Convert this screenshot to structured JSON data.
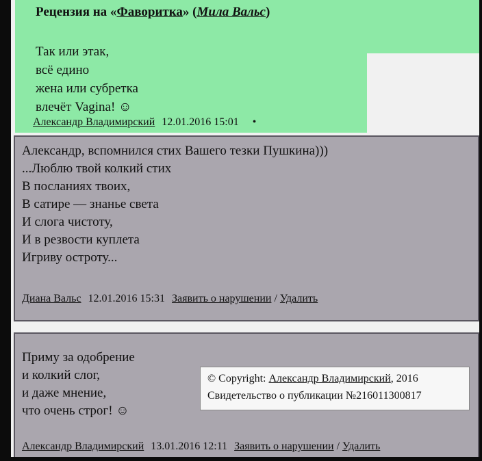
{
  "review": {
    "prefix": "Рецензия на «",
    "work_title": "Фаворитка",
    "mid": "» (",
    "work_author": "Мила Вальс",
    "suffix": ")",
    "poem": [
      "Так или этак,",
      "всё едино",
      "жена или субретка",
      "влечёт Vagina! ☺"
    ],
    "author": "Александр Владимирский",
    "date": "12.01.2016 15:01",
    "bullet": "•"
  },
  "reply1": {
    "lines": [
      "Александр, вспомнился стих Вашего тезки Пушкина)))",
      "...Люблю твой колкий стих",
      "В посланиях твоих,",
      "В сатире — знанье света",
      "И слога чистоту,",
      "И в резвости куплета",
      "Игриву остроту..."
    ],
    "author": "Диана Вальс",
    "date": "12.01.2016 15:31",
    "report": "Заявить о нарушении",
    "sep": "/",
    "delete": "Удалить"
  },
  "reply2": {
    "lines": [
      "Приму за одобрение",
      "и колкий слог,",
      "и даже мнение,",
      "что очень строг! ☺"
    ],
    "author": "Александр Владимирский",
    "date": "13.01.2016 12:11",
    "report": "Заявить о нарушении",
    "sep": "/",
    "delete": "Удалить"
  },
  "copyright": {
    "prefix": "© Copyright: ",
    "author": "Александр Владимирский",
    "year": ", 2016",
    "certificate": "Свидетельство о публикации №216011300817"
  }
}
